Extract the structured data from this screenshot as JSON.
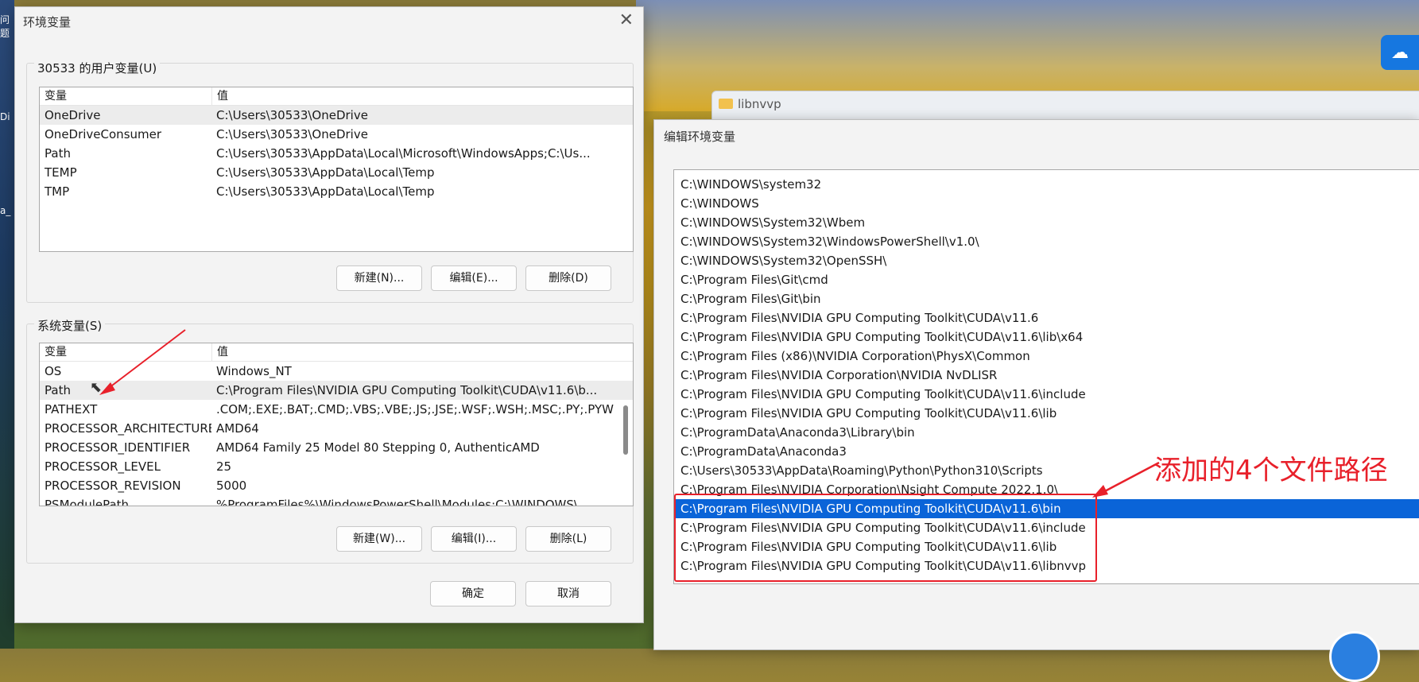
{
  "desktop": {
    "left_fragments": [
      "问题",
      "Di",
      "a_"
    ]
  },
  "env_dialog": {
    "title": "环境变量",
    "close_glyph": "✕",
    "user_section_label": "30533 的用户变量(U)",
    "user_columns": [
      "变量",
      "值"
    ],
    "user_variables": [
      {
        "name": "OneDrive",
        "value": "C:\\Users\\30533\\OneDrive"
      },
      {
        "name": "OneDriveConsumer",
        "value": "C:\\Users\\30533\\OneDrive"
      },
      {
        "name": "Path",
        "value": "C:\\Users\\30533\\AppData\\Local\\Microsoft\\WindowsApps;C:\\Us..."
      },
      {
        "name": "TEMP",
        "value": "C:\\Users\\30533\\AppData\\Local\\Temp"
      },
      {
        "name": "TMP",
        "value": "C:\\Users\\30533\\AppData\\Local\\Temp"
      }
    ],
    "user_buttons": {
      "new": "新建(N)...",
      "edit": "编辑(E)...",
      "delete": "删除(D)"
    },
    "system_section_label": "系统变量(S)",
    "system_columns": [
      "变量",
      "值"
    ],
    "system_variables": [
      {
        "name": "OS",
        "value": "Windows_NT"
      },
      {
        "name": "Path",
        "value": "C:\\Program Files\\NVIDIA GPU Computing Toolkit\\CUDA\\v11.6\\b..."
      },
      {
        "name": "PATHEXT",
        "value": ".COM;.EXE;.BAT;.CMD;.VBS;.VBE;.JS;.JSE;.WSF;.WSH;.MSC;.PY;.PYW"
      },
      {
        "name": "PROCESSOR_ARCHITECTURE",
        "value": "AMD64"
      },
      {
        "name": "PROCESSOR_IDENTIFIER",
        "value": "AMD64 Family 25 Model 80 Stepping 0, AuthenticAMD"
      },
      {
        "name": "PROCESSOR_LEVEL",
        "value": "25"
      },
      {
        "name": "PROCESSOR_REVISION",
        "value": "5000"
      },
      {
        "name": "PSModulePath",
        "value": "%ProgramFiles%\\WindowsPowerShell\\Modules;C:\\WINDOWS\\..."
      }
    ],
    "system_buttons": {
      "new": "新建(W)...",
      "edit": "编辑(I)...",
      "delete": "删除(L)"
    },
    "ok": "确定",
    "cancel": "取消"
  },
  "explorer": {
    "folder_label": "libnvvp"
  },
  "edit_dialog": {
    "title": "编辑环境变量",
    "paths": [
      "C:\\WINDOWS\\system32",
      "C:\\WINDOWS",
      "C:\\WINDOWS\\System32\\Wbem",
      "C:\\WINDOWS\\System32\\WindowsPowerShell\\v1.0\\",
      "C:\\WINDOWS\\System32\\OpenSSH\\",
      "C:\\Program Files\\Git\\cmd",
      "C:\\Program Files\\Git\\bin",
      "C:\\Program Files\\NVIDIA GPU Computing Toolkit\\CUDA\\v11.6",
      "C:\\Program Files\\NVIDIA GPU Computing Toolkit\\CUDA\\v11.6\\lib\\x64",
      "C:\\Program Files (x86)\\NVIDIA Corporation\\PhysX\\Common",
      "C:\\Program Files\\NVIDIA Corporation\\NVIDIA NvDLISR",
      "C:\\Program Files\\NVIDIA GPU Computing Toolkit\\CUDA\\v11.6\\include",
      "C:\\Program Files\\NVIDIA GPU Computing Toolkit\\CUDA\\v11.6\\lib",
      "C:\\ProgramData\\Anaconda3\\Library\\bin",
      "C:\\ProgramData\\Anaconda3",
      "C:\\Users\\30533\\AppData\\Roaming\\Python\\Python310\\Scripts",
      "C:\\Program Files\\NVIDIA Corporation\\Nsight Compute 2022.1.0\\",
      "C:\\Program Files\\NVIDIA GPU Computing Toolkit\\CUDA\\v11.6\\bin",
      "C:\\Program Files\\NVIDIA GPU Computing Toolkit\\CUDA\\v11.6\\include",
      "C:\\Program Files\\NVIDIA GPU Computing Toolkit\\CUDA\\v11.6\\lib",
      "C:\\Program Files\\NVIDIA GPU Computing Toolkit\\CUDA\\v11.6\\libnvvp"
    ],
    "selected_index": 17
  },
  "annotation": {
    "text": "添加的4个文件路径",
    "color": "#e8202a"
  },
  "colors": {
    "selection": "#0a64d8",
    "annotation_red": "#e8202a"
  }
}
